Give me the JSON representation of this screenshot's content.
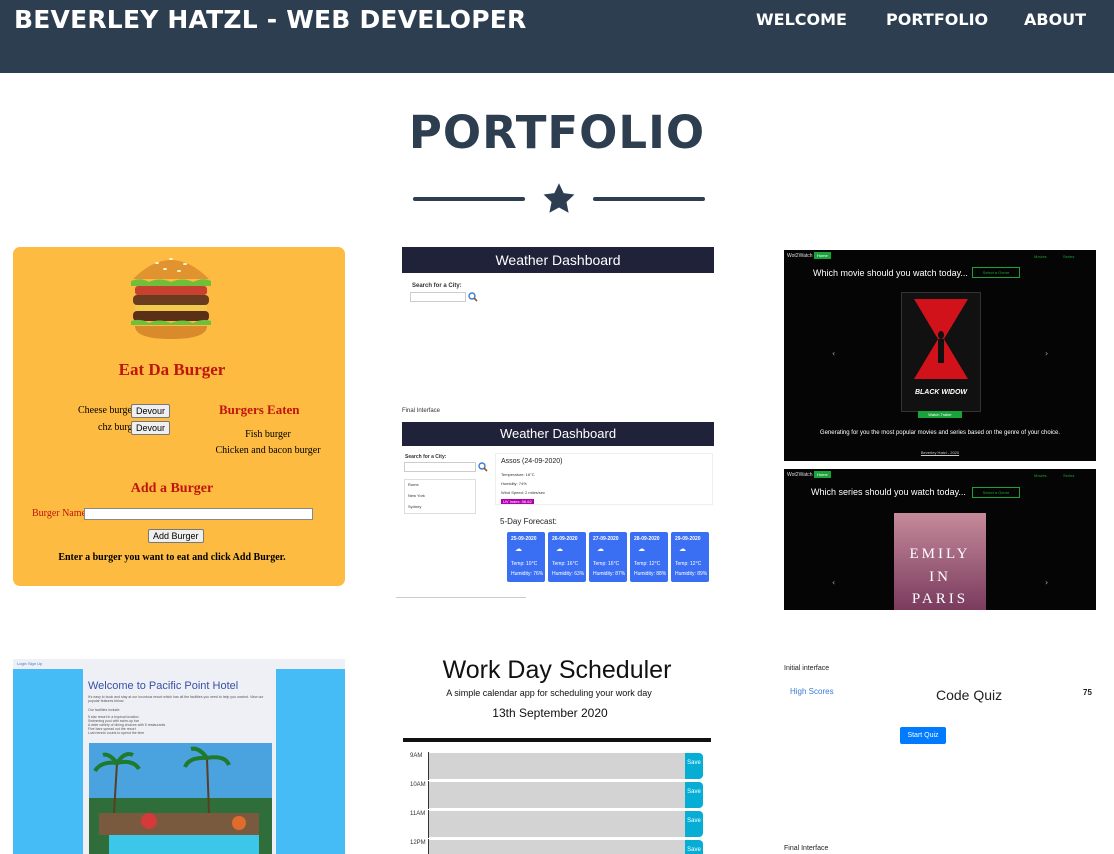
{
  "nav": {
    "brand": "BEVERLEY HATZL - WEB DEVELOPER",
    "links": [
      "WELCOME",
      "PORTFOLIO",
      "ABOUT"
    ]
  },
  "section": {
    "title": "PORTFOLIO"
  },
  "colors": {
    "nav": "#2c3e50",
    "burger_bg": "#fdbb42",
    "pacific_bg": "#45bcf6",
    "scheduler_save": "#06aed5",
    "quiz_button": "#007bff"
  },
  "projects": {
    "burger": {
      "title": "Eat Da Burger",
      "items": [
        {
          "name": "Cheese burger",
          "button": "Devour"
        },
        {
          "name": "chz burg",
          "button": "Devour"
        }
      ],
      "eaten_heading": "Burgers Eaten",
      "eaten": [
        "Fish burger",
        "Chicken and bacon burger"
      ],
      "add_heading": "Add a Burger",
      "input_label": "Burger Name:",
      "add_button": "Add Burger",
      "instruction": "Enter a burger you want to eat and click Add Burger."
    },
    "weather": {
      "title": "Weather Dashboard",
      "search_label": "Search for a City:",
      "final_label": "Final Interface",
      "cities": [
        "Rome",
        "New York",
        "Sydney"
      ],
      "city_heading": "Assos (24-09-2020)",
      "details": [
        "Temperature: 16°C",
        "Humidity: 74%",
        "Wind Speed: 2 miles/sec",
        "UV Index: 56.62"
      ],
      "forecast_heading": "5-Day Forecast:",
      "forecast": [
        {
          "date": "25-09-2020",
          "temp": "Temp: 10°C",
          "humidity": "Humidity: 76%"
        },
        {
          "date": "26-09-2020",
          "temp": "Temp: 16°C",
          "humidity": "Humidity: 63%"
        },
        {
          "date": "27-09-2020",
          "temp": "Temp: 16°C",
          "humidity": "Humidity: 87%"
        },
        {
          "date": "28-09-2020",
          "temp": "Temp: 12°C",
          "humidity": "Humidity: 88%"
        },
        {
          "date": "29-09-2020",
          "temp": "Temp: 12°C",
          "humidity": "Humidity: 89%"
        }
      ]
    },
    "watch": {
      "logo": "Wot2Watch",
      "badge": "Home",
      "movie_question": "Which movie should you watch today...",
      "series_question": "Which series should you watch today...",
      "select": "Select a Genre",
      "poster1": "BLACK WIDOW",
      "trailer": "Watch Trailer",
      "caption": "Generating for you the most popular movies and series based on the genre of your choice.",
      "footer": "Beverley Hatzl - 2020",
      "menu": [
        "Movies",
        "Series"
      ],
      "poster2": [
        "EMILY",
        "IN",
        "PARIS"
      ]
    },
    "hotel": {
      "nav": [
        "Login",
        "Sign Up"
      ],
      "title": "Welcome to Pacific Point Hotel",
      "intro": "It's easy to book and stay at our luxurious resort which has all the facilities you need to help you unwind. View our popular features below.",
      "facilities_label": "Our facilities include:",
      "facilities": [
        "5 star resort in a tropical location",
        "Swimming pool with swim-up bar",
        "A wide variety of dining choices with 5 restaurants",
        "Five bars spread out the resort",
        "Lush tennis courts to spend the time"
      ]
    },
    "scheduler": {
      "title": "Work Day Scheduler",
      "subtitle": "A simple calendar app for scheduling your work day",
      "date": "13th September 2020",
      "hours": [
        "9AM",
        "10AM",
        "11AM",
        "12PM"
      ],
      "save": "Save"
    },
    "quiz": {
      "initial_label": "Initial interface",
      "high_scores": "High Scores",
      "title": "Code Quiz",
      "score": "75",
      "start": "Start Quiz",
      "final_label": "Final Interface"
    }
  }
}
